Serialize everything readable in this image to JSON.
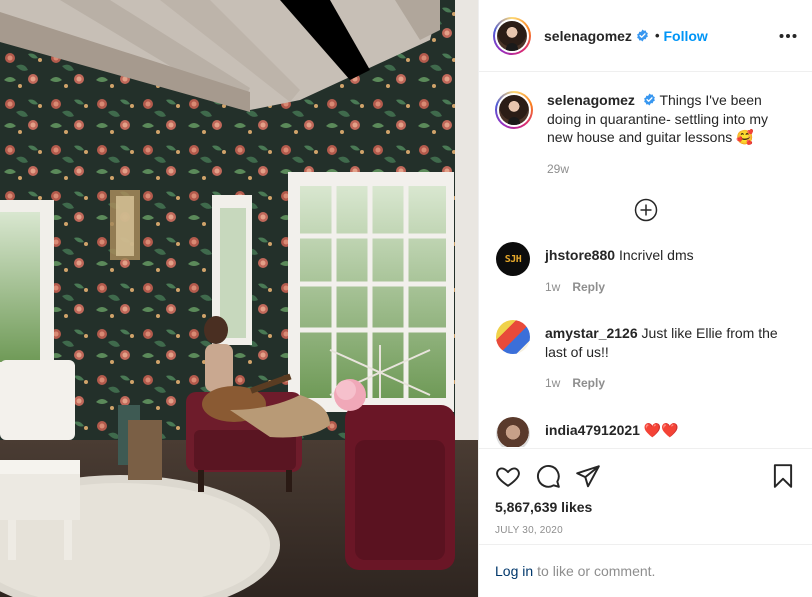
{
  "post": {
    "username": "selenagomez",
    "follow_label": "Follow",
    "separator": "•"
  },
  "caption": {
    "username": "selenagomez",
    "text": "Things I've been doing in quarantine- settling into my new house and guitar lessons 🥰",
    "time": "29w"
  },
  "comments": [
    {
      "username": "jhstore880",
      "text": "Incrivel dms",
      "time": "1w",
      "reply_label": "Reply",
      "avatar_text": "SJH"
    },
    {
      "username": "amystar_2126",
      "text": "Just like Ellie from the last of us!!",
      "time": "1w",
      "reply_label": "Reply"
    },
    {
      "username": "india47912021",
      "text": "❤️❤️",
      "time": "",
      "reply_label": ""
    }
  ],
  "actions": {
    "likes": "5,867,639 likes",
    "date": "JULY 30, 2020"
  },
  "login": {
    "link_label": "Log in",
    "suffix": "to like or comment."
  },
  "icons": {
    "more": "more-options-icon",
    "verified": "verified-badge-icon",
    "load_more": "plus-circle-icon",
    "like": "heart-icon",
    "comment": "comment-icon",
    "share": "paper-plane-icon",
    "save": "bookmark-icon"
  },
  "colors": {
    "accent": "#0095f6",
    "link": "#00376b",
    "muted": "#8e8e8e",
    "text": "#262626",
    "verified": "#3897f0"
  }
}
